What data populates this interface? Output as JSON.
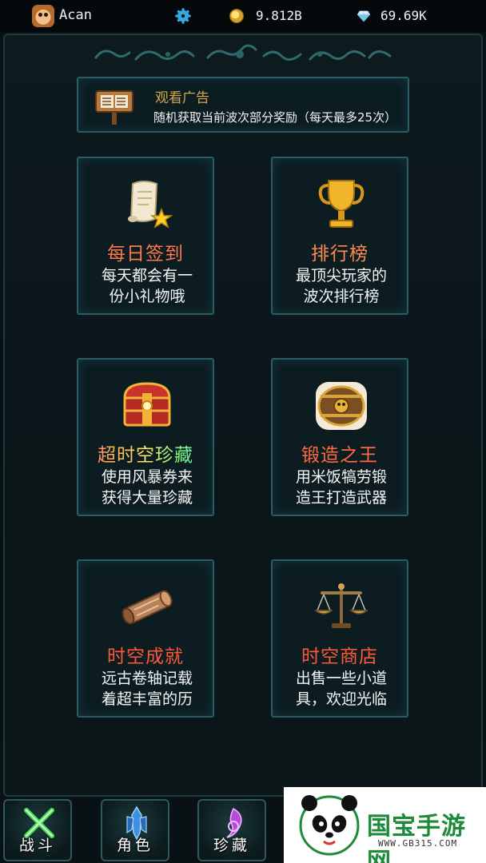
{
  "header": {
    "username": "Acan",
    "coins": "9.812B",
    "gems": "69.69K"
  },
  "ad_banner": {
    "title": "观看广告",
    "description": "随机获取当前波次部分奖励（每天最多25次）"
  },
  "cards": [
    {
      "title": "每日签到",
      "line1": "每天都会有一",
      "line2": "份小礼物哦",
      "icon": "scroll-star-icon"
    },
    {
      "title": "排行榜",
      "line1": "最顶尖玩家的",
      "line2": "波次排行榜",
      "icon": "trophy-icon"
    },
    {
      "title": "超时空珍藏",
      "line1": "使用风暴券来",
      "line2": "获得大量珍藏",
      "icon": "treasure-chest-icon"
    },
    {
      "title": "锻造之王",
      "line1": "用米饭犒劳锻",
      "line2": "造王打造武器",
      "icon": "barrel-icon"
    },
    {
      "title": "时空成就",
      "line1": "远古卷轴记载",
      "line2": "着超丰富的历",
      "icon": "ancient-scroll-icon"
    },
    {
      "title": "时空商店",
      "line1": "出售一些小道",
      "line2": "具，欢迎光临",
      "icon": "scales-icon"
    }
  ],
  "nav": {
    "battle": "战斗",
    "role": "角色",
    "treasure": "珍藏"
  },
  "watermark": {
    "name": "国宝手游网",
    "url": "WWW.GB315.COM"
  },
  "colors": {
    "background": "#0a1114",
    "card_border": "#2a5c64",
    "accent_blue": "#3aa8e0",
    "title_orange": "#ff7a4a",
    "ad_title": "#d9a44a"
  }
}
